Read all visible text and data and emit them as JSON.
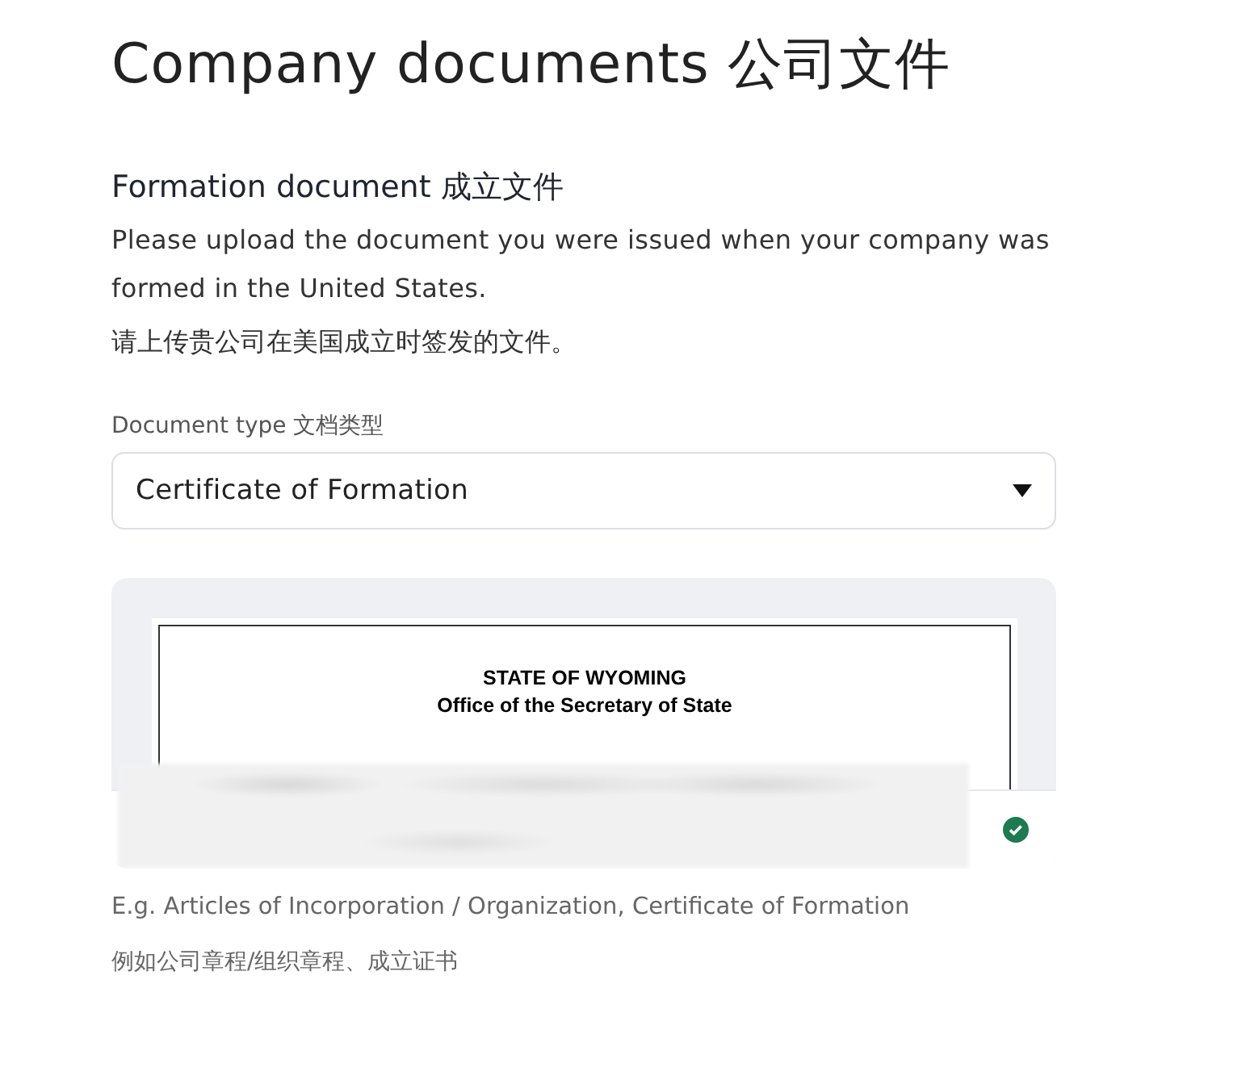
{
  "title": "Company documents 公司文件",
  "section": {
    "heading": "Formation document 成立文件",
    "description": "Please upload the document you were issued when your company was formed in the United States.",
    "description_zh": "请上传贵公司在美国成立时签发的文件。"
  },
  "document_type": {
    "label": "Document type 文档类型",
    "value": "Certificate of Formation"
  },
  "preview": {
    "doc_lines": [
      "STATE OF WYOMING",
      "Office of the Secretary of State"
    ],
    "uploaded": true
  },
  "hint": "E.g. Articles of Incorporation / Organization, Certificate of Formation",
  "hint_zh": "例如公司章程/组织章程、成立证书"
}
